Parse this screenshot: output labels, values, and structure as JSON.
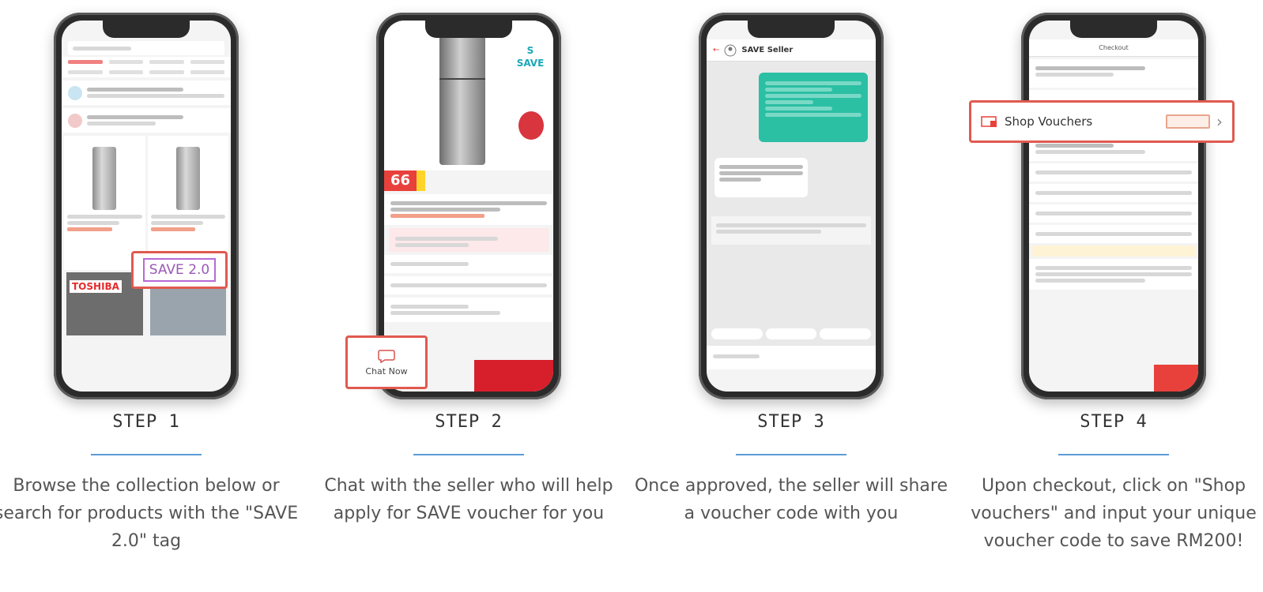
{
  "steps": [
    {
      "title": "STEP 1",
      "description": "Browse the collection below or search for products with the \"SAVE 2.0\" tag",
      "callout": "SAVE 2.0"
    },
    {
      "title": "STEP 2",
      "description": "Chat with the seller who will help apply for SAVE voucher for you",
      "callout": "Chat Now",
      "badge": "66"
    },
    {
      "title": "STEP 3",
      "description": "Once approved, the seller will share a voucher code with you",
      "seller_name": "SAVE Seller"
    },
    {
      "title": "STEP 4",
      "description": "Upon checkout, click on \"Shop vouchers\" and input your unique voucher code to save RM200!",
      "callout": "Shop Vouchers",
      "screen_title": "Checkout"
    }
  ],
  "colors": {
    "highlight_border": "#e05a4f",
    "divider": "#5b9bd5",
    "save_tag": "#9b59b6",
    "chat_green": "#2bbfa4",
    "shopee_red": "#e8413c"
  }
}
